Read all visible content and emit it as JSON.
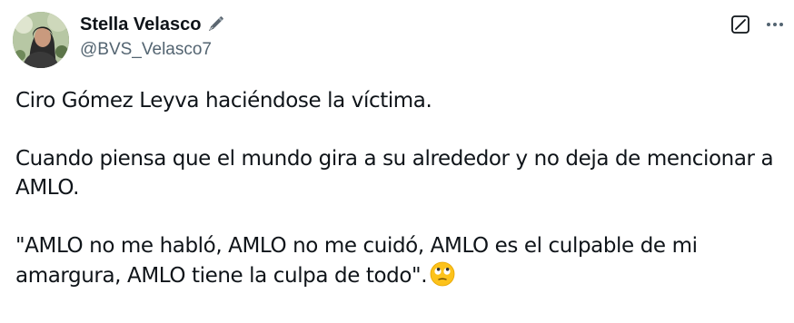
{
  "author": {
    "display_name": "Stella Velasco",
    "handle": "@BVS_Velasco7",
    "name_emoji": "pen-icon"
  },
  "actions": {
    "grok_icon": "grok-icon",
    "more_icon": "more-icon"
  },
  "tweet": {
    "paragraph_1": "Ciro Gómez Leyva haciéndose la víctima.",
    "paragraph_2": "Cuando piensa que el mundo gira a su alrededor y no deja de mencionar a AMLO.",
    "paragraph_3": "\"AMLO no me habló, AMLO no me cuidó, AMLO es el culpable de mi amargura, AMLO tiene la culpa de todo\".",
    "trailing_emoji": "face-with-rolling-eyes-emoji"
  },
  "colors": {
    "text_primary": "#0f1419",
    "text_secondary": "#536471",
    "background": "#ffffff"
  }
}
